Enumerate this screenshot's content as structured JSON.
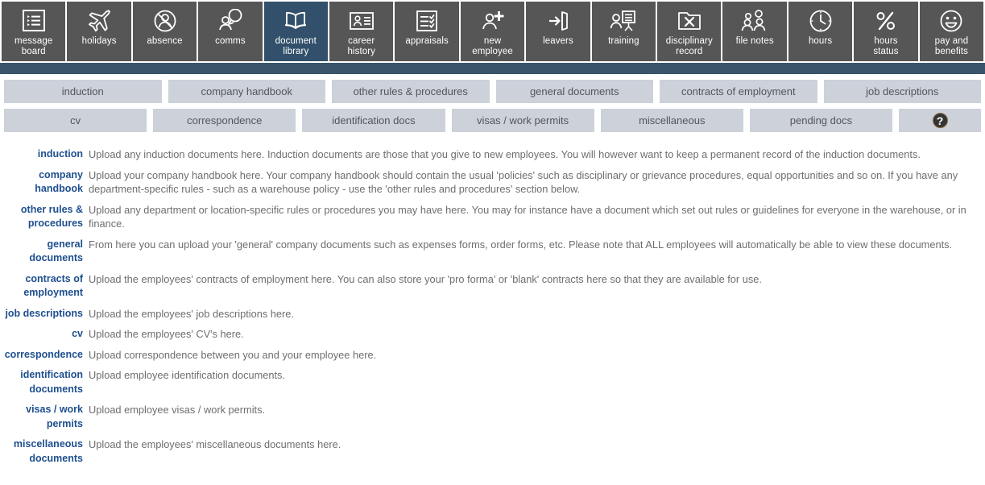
{
  "toolbar": {
    "items": [
      {
        "label": "message\nboard",
        "icon": "message-board-icon",
        "active": false
      },
      {
        "label": "holidays",
        "icon": "airplane-icon",
        "active": false
      },
      {
        "label": "absence",
        "icon": "absence-person-crossed-icon",
        "active": false
      },
      {
        "label": "comms",
        "icon": "comms-speech-bubble-icon",
        "active": false
      },
      {
        "label": "document\nlibrary",
        "icon": "open-book-icon",
        "active": true
      },
      {
        "label": "career\nhistory",
        "icon": "id-card-icon",
        "active": false
      },
      {
        "label": "appraisals",
        "icon": "checklist-icon",
        "active": false
      },
      {
        "label": "new\nemployee",
        "icon": "person-plus-icon",
        "active": false
      },
      {
        "label": "leavers",
        "icon": "exit-door-icon",
        "active": false
      },
      {
        "label": "training",
        "icon": "training-board-icon",
        "active": false
      },
      {
        "label": "disciplinary\nrecord",
        "icon": "folder-cross-icon",
        "active": false
      },
      {
        "label": "file notes",
        "icon": "two-people-notes-icon",
        "active": false
      },
      {
        "label": "hours",
        "icon": "clock-icon",
        "active": false
      },
      {
        "label": "hours\nstatus",
        "icon": "percent-icon",
        "active": false
      },
      {
        "label": "pay and\nbenefits",
        "icon": "smiley-face-icon",
        "active": false
      }
    ]
  },
  "subnav": {
    "row1": [
      {
        "label": "induction"
      },
      {
        "label": "company handbook"
      },
      {
        "label": "other rules & procedures"
      },
      {
        "label": "general documents"
      },
      {
        "label": "contracts of employment"
      },
      {
        "label": "job descriptions"
      }
    ],
    "row2": [
      {
        "label": "cv"
      },
      {
        "label": "correspondence"
      },
      {
        "label": "identification docs"
      },
      {
        "label": "visas / work permits"
      },
      {
        "label": "miscellaneous"
      },
      {
        "label": "pending docs"
      }
    ],
    "help": {
      "glyph": "?",
      "icon": "help-question-icon"
    }
  },
  "descriptions": [
    {
      "term": "induction",
      "text": "Upload any induction documents here. Induction documents are those that you give to new employees. You will however want to keep a permanent record of the induction documents."
    },
    {
      "term": "company handbook",
      "text": "Upload your company handbook here. Your company handbook should contain the usual 'policies' such as disciplinary or grievance procedures, equal opportunities and so on. If you have any department-specific rules - such as a warehouse policy - use the 'other rules and procedures' section below."
    },
    {
      "term": "other rules & procedures",
      "text": "Upload any department or location-specific rules or procedures you may have here. You may for instance have a document which set out rules or guidelines for everyone in the warehouse, or in finance."
    },
    {
      "term": "general documents",
      "text": "From here you can upload your 'general' company documents such as expenses forms, order forms, etc. Please note that ALL employees will automatically be able to view these documents."
    },
    {
      "term": "contracts of employment",
      "text": "Upload the employees' contracts of employment here. You can also store your 'pro forma' or 'blank' contracts here so that they are available for use."
    },
    {
      "term": "job descriptions",
      "text": "Upload the employees' job descriptions here."
    },
    {
      "term": "cv",
      "text": "Upload the employees' CV's here."
    },
    {
      "term": "correspondence",
      "text": "Upload correspondence between you and your employee here."
    },
    {
      "term": "identification documents",
      "text": "Upload employee identification documents."
    },
    {
      "term": "visas / work permits",
      "text": "Upload employee visas / work permits."
    },
    {
      "term": "miscellaneous documents",
      "text": "Upload the employees' miscellaneous documents here."
    }
  ],
  "colors": {
    "toolbar_bg": "#565656",
    "toolbar_active": "#32506b",
    "divider_bar": "#3a546b",
    "subnav_btn": "#ccd1da",
    "term_text": "#1e4f8f",
    "body_text": "#6d6e71"
  }
}
